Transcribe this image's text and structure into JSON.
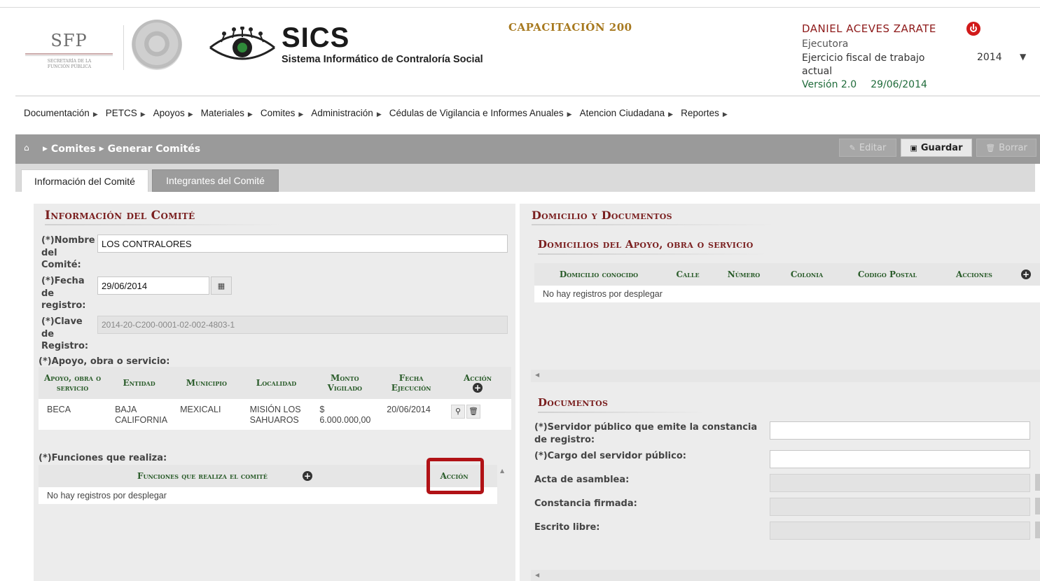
{
  "header": {
    "sfp_logo": "SFP",
    "sfp_subtitle": "SECRETARÍA DE LA FUNCIÓN PÚBLICA",
    "app_name": "SICS",
    "app_fullname": "Sistema Informático de Contraloría Social",
    "program": "CAPACITACIÓN 200",
    "user_name": "DANIEL ACEVES ZARATE",
    "user_role": "Ejecutora",
    "fiscal_label": "Ejercicio fiscal de trabajo actual",
    "fiscal_year": "2014",
    "version": "Versión 2.0",
    "date": "29/06/2014"
  },
  "menu": {
    "items": [
      "Documentación",
      "PETCS",
      "Apoyos",
      "Materiales",
      "Comites",
      "Administración",
      "Cédulas de Vigilancia e Informes Anuales",
      "Atencion Ciudadana",
      "Reportes"
    ]
  },
  "toolbar": {
    "breadcrumb": [
      "Comites",
      "Generar Comités"
    ],
    "edit_label": "Editar",
    "save_label": "Guardar",
    "delete_label": "Borrar"
  },
  "tabs": [
    {
      "label": "Información del Comité",
      "active": true
    },
    {
      "label": "Integrantes del Comité",
      "active": false
    }
  ],
  "left": {
    "title": "Información del Comité",
    "nombre_label": "(*)Nombre del Comité:",
    "nombre_value": "LOS CONTRALORES",
    "fecha_label": "(*)Fecha de registro:",
    "fecha_value": "29/06/2014",
    "clave_label": "(*)Clave de Registro:",
    "clave_value": "2014-20-C200-0001-02-002-4803-1",
    "apoyo_label": "(*)Apoyo, obra o servicio:",
    "apoyo_columns": [
      "Apoyo, obra o servicio",
      "Entidad",
      "Municipio",
      "Localidad",
      "Monto Vigilado",
      "Fecha Ejecución",
      "Acción"
    ],
    "apoyo_rows": [
      {
        "apoyo": "BECA",
        "entidad": "BAJA CALIFORNIA",
        "municipio": "MEXICALI",
        "localidad": "MISIÓN LOS SAHUAROS",
        "monto": "$ 6.000.000,00",
        "fecha": "20/06/2014"
      }
    ],
    "funciones_label": "(*)Funciones que realiza:",
    "funciones_columns": [
      "Funciones que realiza el comité",
      "Acción"
    ],
    "funciones_empty": "No hay registros por desplegar"
  },
  "right": {
    "title": "Domicilio y Documentos",
    "domicilios_title": "Domicilios del Apoyo, obra o servicio",
    "domicilios_columns": [
      "Domicilio conocido",
      "Calle",
      "Número",
      "Colonia",
      "Codigo Postal",
      "Acciones"
    ],
    "domicilios_empty": "No hay registros por desplegar",
    "documentos_title": "Documentos",
    "servidor_label": "(*)Servidor público que emite la constancia de registro:",
    "cargo_label": "(*)Cargo del servidor público:",
    "acta_label": "Acta de asamblea:",
    "constancia_label": "Constancia firmada:",
    "escrito_label": "Escrito libre:"
  },
  "colors": {
    "accent_red": "#7a1f1f",
    "user_red": "#8e1a1a",
    "program_gold": "#a7791f",
    "version_green": "#1f6b3a",
    "highlight": "#b11216"
  },
  "icons": [
    "home-icon",
    "power-icon",
    "calendar-icon",
    "plus-icon",
    "search-icon",
    "trash-icon",
    "save-icon",
    "pencil-icon",
    "chevron-down-icon"
  ]
}
